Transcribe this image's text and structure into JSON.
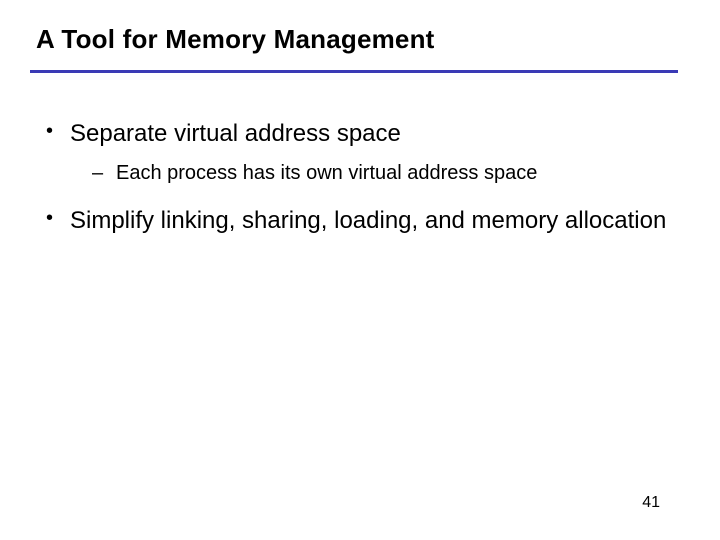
{
  "title": "A Tool for Memory Management",
  "bullets": {
    "b1": "Separate virtual address space",
    "b1_sub1": "Each process has its own virtual address space",
    "b2": "Simplify linking, sharing, loading, and memory allocation"
  },
  "page_number": "41",
  "accent_color": "#3a3ab5"
}
